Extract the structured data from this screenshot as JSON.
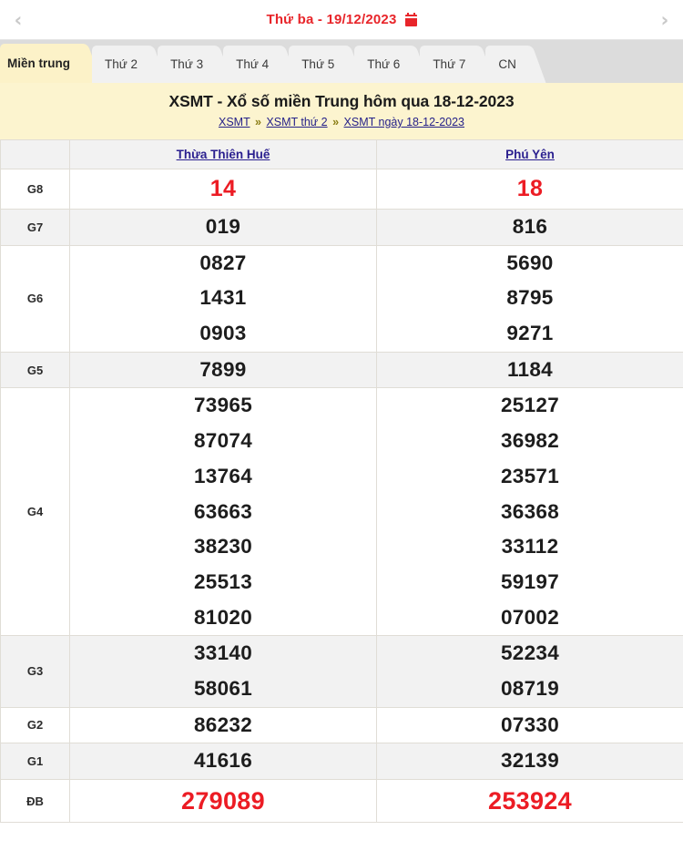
{
  "datebar": {
    "prev_label": "‹",
    "next_label": "›",
    "date_text": "Thứ ba -  19/12/2023",
    "calendar_icon": "calendar-icon"
  },
  "tabs": [
    {
      "label": "Miền trung",
      "active": true
    },
    {
      "label": "Thứ 2",
      "active": false
    },
    {
      "label": "Thứ 3",
      "active": false
    },
    {
      "label": "Thứ 4",
      "active": false
    },
    {
      "label": "Thứ 5",
      "active": false
    },
    {
      "label": "Thứ 6",
      "active": false
    },
    {
      "label": "Thứ 7",
      "active": false
    },
    {
      "label": "CN",
      "active": false
    }
  ],
  "title": {
    "heading": "XSMT - Xổ số miền Trung hôm qua 18-12-2023",
    "breadcrumb": [
      "XSMT",
      "XSMT thứ 2",
      "XSMT ngày 18-12-2023"
    ],
    "breadcrumb_separator": "»"
  },
  "table": {
    "provinces": [
      "Thừa Thiên Huế",
      "Phú Yên"
    ],
    "rows": [
      {
        "prize": "G8",
        "style": "red",
        "shade": false,
        "hue": [
          "14"
        ],
        "phuyen": [
          "18"
        ]
      },
      {
        "prize": "G7",
        "style": "black",
        "shade": true,
        "hue": [
          "019"
        ],
        "phuyen": [
          "816"
        ]
      },
      {
        "prize": "G6",
        "style": "black",
        "shade": false,
        "hue": [
          "0827",
          "1431",
          "0903"
        ],
        "phuyen": [
          "5690",
          "8795",
          "9271"
        ]
      },
      {
        "prize": "G5",
        "style": "black",
        "shade": true,
        "hue": [
          "7899"
        ],
        "phuyen": [
          "1184"
        ]
      },
      {
        "prize": "G4",
        "style": "black",
        "shade": false,
        "hue": [
          "73965",
          "87074",
          "13764",
          "63663",
          "38230",
          "25513",
          "81020"
        ],
        "phuyen": [
          "25127",
          "36982",
          "23571",
          "36368",
          "33112",
          "59197",
          "07002"
        ]
      },
      {
        "prize": "G3",
        "style": "black",
        "shade": true,
        "hue": [
          "33140",
          "58061"
        ],
        "phuyen": [
          "52234",
          "08719"
        ]
      },
      {
        "prize": "G2",
        "style": "black",
        "shade": false,
        "hue": [
          "86232"
        ],
        "phuyen": [
          "07330"
        ]
      },
      {
        "prize": "G1",
        "style": "black",
        "shade": true,
        "hue": [
          "41616"
        ],
        "phuyen": [
          "32139"
        ]
      },
      {
        "prize": "ĐB",
        "style": "db",
        "shade": false,
        "hue": [
          "279089"
        ],
        "phuyen": [
          "253924"
        ]
      }
    ]
  },
  "colors": {
    "accent_red": "#ec1c24",
    "title_bg": "#fcf4cf",
    "active_tab": "#fcf2c8",
    "link_blue": "#2a1f8f",
    "shade_row": "#f2f2f2"
  }
}
